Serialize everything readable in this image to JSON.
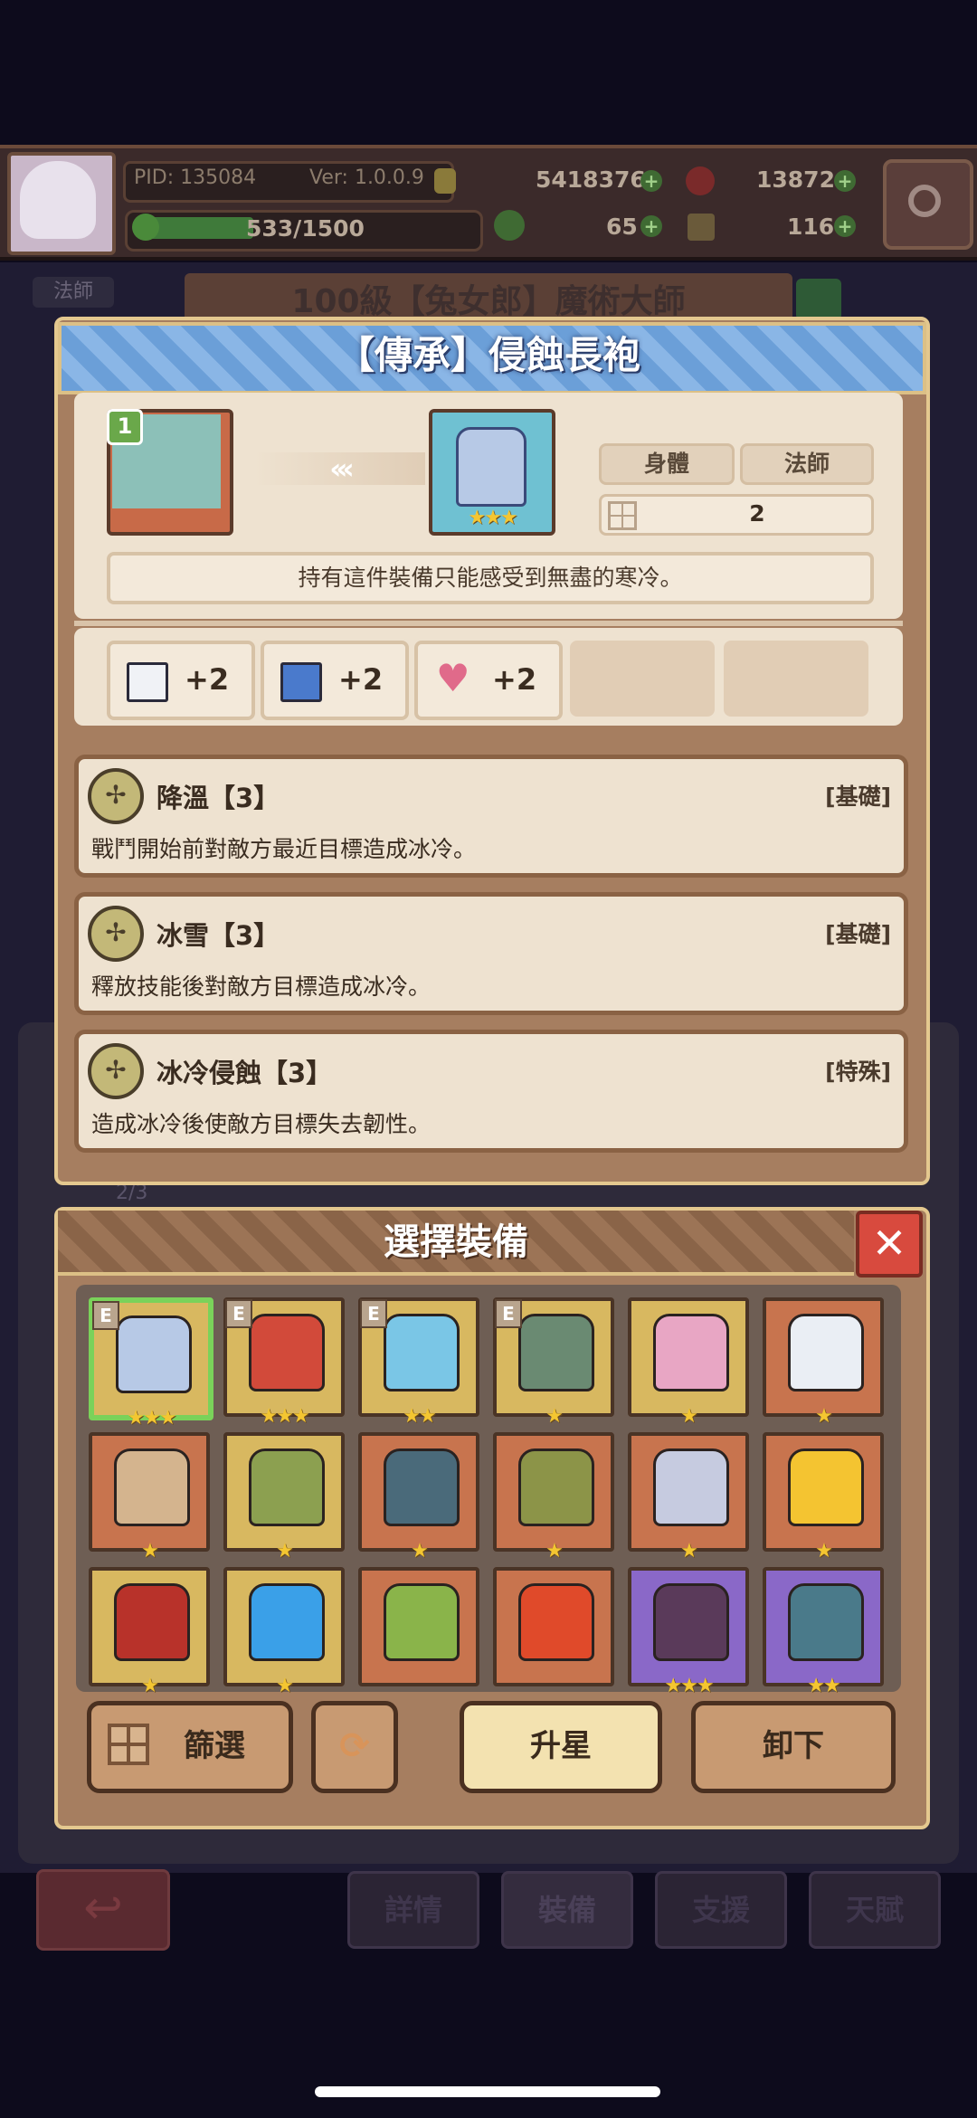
{
  "header": {
    "pid": "PID: 135084",
    "version": "Ver: 1.0.0.9",
    "gold": "5418376",
    "gems": "13872",
    "stamina": "533/1500",
    "clover": "65",
    "keys": "116"
  },
  "background": {
    "class_tag": "法師",
    "hero_title": "100級【兔女郎】魔術大師",
    "page_count": "2/3",
    "tabs": [
      "詳情",
      "裝備",
      "支援",
      "天賦"
    ]
  },
  "item_detail": {
    "title": "【傳承】侵蝕長袍",
    "hero_level": "1",
    "arrows": "‹‹‹",
    "item_stars": "★★★",
    "slot_tag": "身體",
    "class_tag": "法師",
    "grid_value": "2",
    "description": "持有這件裝備只能感受到無盡的寒冷。",
    "stats": [
      {
        "icon": "book-icon",
        "value": "+2"
      },
      {
        "icon": "boot-icon",
        "value": "+2"
      },
      {
        "icon": "heart-icon",
        "value": "+2"
      }
    ],
    "skills": [
      {
        "name": "降溫【3】",
        "type": "[基礎]",
        "desc": "戰鬥開始前對敵方最近目標造成冰冷。"
      },
      {
        "name": "冰雪【3】",
        "type": "[基礎]",
        "desc": "釋放技能後對敵方目標造成冰冷。"
      },
      {
        "name": "冰冷侵蝕【3】",
        "type": "[特殊]",
        "desc": "造成冰冷後使敵方目標失去韌性。"
      }
    ]
  },
  "equipment_select": {
    "title": "選擇裝備",
    "close": "✕",
    "items": [
      {
        "bg": "gold",
        "color": "#b7c9e6",
        "stars": "★★★",
        "equipped": "E"
      },
      {
        "bg": "gold",
        "color": "#d24a3a",
        "stars": "★★★",
        "equipped": "E"
      },
      {
        "bg": "gold",
        "color": "#7ac6e6",
        "stars": "★★",
        "equipped": "E"
      },
      {
        "bg": "gold",
        "color": "#6a8a72",
        "stars": "★",
        "equipped": "E"
      },
      {
        "bg": "gold",
        "color": "#e8a6c4",
        "stars": "★",
        "equipped": ""
      },
      {
        "bg": "orange",
        "color": "#eaeef4",
        "stars": "★",
        "equipped": ""
      },
      {
        "bg": "orange",
        "color": "#d4b48e",
        "stars": "★",
        "equipped": ""
      },
      {
        "bg": "gold",
        "color": "#8ca050",
        "stars": "★",
        "equipped": ""
      },
      {
        "bg": "orange",
        "color": "#4a6a7a",
        "stars": "★",
        "equipped": ""
      },
      {
        "bg": "orange",
        "color": "#8c9448",
        "stars": "★",
        "equipped": ""
      },
      {
        "bg": "orange",
        "color": "#c6cbe0",
        "stars": "★",
        "equipped": ""
      },
      {
        "bg": "orange",
        "color": "#f4c431",
        "stars": "★",
        "equipped": ""
      },
      {
        "bg": "gold",
        "color": "#b8322a",
        "stars": "★",
        "equipped": ""
      },
      {
        "bg": "gold",
        "color": "#3aa0e8",
        "stars": "★",
        "equipped": ""
      },
      {
        "bg": "orange",
        "color": "#8ab44a",
        "stars": "",
        "equipped": ""
      },
      {
        "bg": "orange",
        "color": "#e04a2a",
        "stars": "",
        "equipped": ""
      },
      {
        "bg": "purple",
        "color": "#5a3a5a",
        "stars": "★★★",
        "equipped": ""
      },
      {
        "bg": "purple",
        "color": "#4a7a8a",
        "stars": "★★",
        "equipped": ""
      }
    ],
    "buttons": {
      "filter": "篩選",
      "upgrade": "升星",
      "unequip": "卸下"
    }
  }
}
